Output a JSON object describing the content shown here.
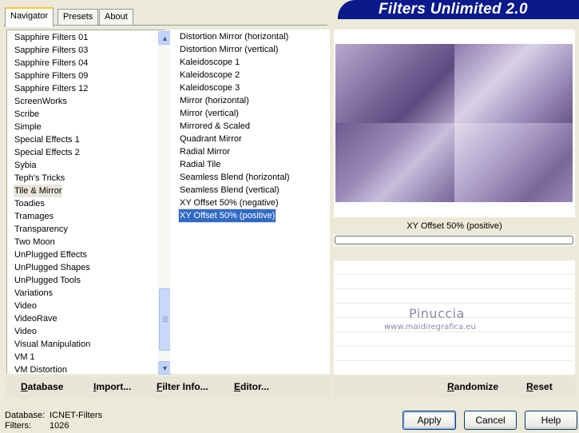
{
  "banner": {
    "title": "Filters Unlimited 2.0"
  },
  "tabs": [
    {
      "label": "Navigator",
      "active": true
    },
    {
      "label": "Presets",
      "active": false
    },
    {
      "label": "About",
      "active": false
    }
  ],
  "categories": {
    "selected": "Tile & Mirror",
    "items": [
      "Sapphire Filters 01",
      "Sapphire Filters 03",
      "Sapphire Filters 04",
      "Sapphire Filters 09",
      "Sapphire Filters 12",
      "ScreenWorks",
      "Scribe",
      "Simple",
      "Special Effects 1",
      "Special Effects 2",
      "Sybia",
      "Teph's Tricks",
      "Tile & Mirror",
      "Toadies",
      "Tramages",
      "Transparency",
      "Two Moon",
      "UnPlugged Effects",
      "UnPlugged Shapes",
      "UnPlugged Tools",
      "Variations",
      "Video",
      "VideoRave",
      "Video",
      "Visual Manipulation",
      "VM 1",
      "VM Distortion"
    ]
  },
  "filters": {
    "selected": "XY Offset 50% (positive)",
    "items": [
      "Distortion Mirror (horizontal)",
      "Distortion Mirror (vertical)",
      "Kaleidoscope 1",
      "Kaleidoscope 2",
      "Kaleidoscope 3",
      "Mirror (horizontal)",
      "Mirror (vertical)",
      "Mirrored & Scaled",
      "Quadrant Mirror",
      "Radial Mirror",
      "Radial Tile",
      "Seamless Blend (horizontal)",
      "Seamless Blend (vertical)",
      "XY Offset 50% (negative)",
      "XY Offset 50% (positive)"
    ]
  },
  "preview": {
    "filter_name": "XY Offset 50% (positive)",
    "progress": 0
  },
  "watermark": {
    "name": "Pinuccia",
    "url": "www.maidiregrafica.eu"
  },
  "toolbar": {
    "database": "Database",
    "import": "Import...",
    "filter_info": "Filter Info...",
    "editor": "Editor...",
    "randomize": "Randomize",
    "reset": "Reset"
  },
  "status": {
    "database_label": "Database:",
    "database_value": "ICNET-Filters",
    "filters_label": "Filters:",
    "filters_value": "1026"
  },
  "buttons": {
    "apply": "Apply",
    "cancel": "Cancel",
    "help": "Help"
  },
  "colors": {
    "banner": "#0a1a8a",
    "selection": "#316ac5",
    "window": "#ece9d8"
  }
}
